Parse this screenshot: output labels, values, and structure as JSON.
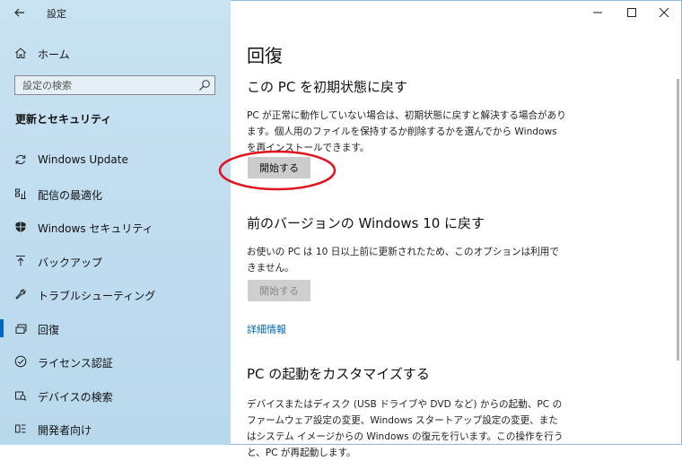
{
  "window": {
    "title": "設定",
    "accent": "#0067c0",
    "sidebar_bg": "#c0dcee"
  },
  "sidebar": {
    "home_label": "ホーム",
    "search_placeholder": "設定の検索",
    "section_title": "更新とセキュリティ",
    "items": [
      {
        "label": "Windows Update",
        "icon": "refresh-icon"
      },
      {
        "label": "配信の最適化",
        "icon": "delivery-optimization-icon"
      },
      {
        "label": "Windows セキュリティ",
        "icon": "shield-icon"
      },
      {
        "label": "バックアップ",
        "icon": "backup-arrow-icon"
      },
      {
        "label": "トラブルシューティング",
        "icon": "wrench-icon"
      },
      {
        "label": "回復",
        "icon": "recovery-icon",
        "selected": true
      },
      {
        "label": "ライセンス認証",
        "icon": "check-circle-icon"
      },
      {
        "label": "デバイスの検索",
        "icon": "find-device-icon"
      },
      {
        "label": "開発者向け",
        "icon": "developer-icon"
      }
    ]
  },
  "main": {
    "title": "回復",
    "reset": {
      "heading": "この PC を初期状態に戻す",
      "desc": "PC が正常に動作していない場合は、初期状態に戻すと解決する場合があります。個人用のファイルを保持するか削除するかを選んでから Windows を再インストールできます。",
      "button": "開始する"
    },
    "goback": {
      "heading": "前のバージョンの Windows 10 に戻す",
      "desc": "お使いの PC は 10 日以上前に更新されたため、このオプションは利用できません。",
      "button": "開始する"
    },
    "more_info": "詳細情報",
    "advanced": {
      "heading": "PC の起動をカスタマイズする",
      "desc": "デバイスまたはディスク (USB ドライブや DVD など) からの起動、PC のファームウェア設定の変更、Windows スタートアップ設定の変更、またはシステム イメージからの Windows の復元を行います。この操作を行うと、PC が再起動します。"
    }
  },
  "annotation": {
    "color": "#e0141e"
  }
}
